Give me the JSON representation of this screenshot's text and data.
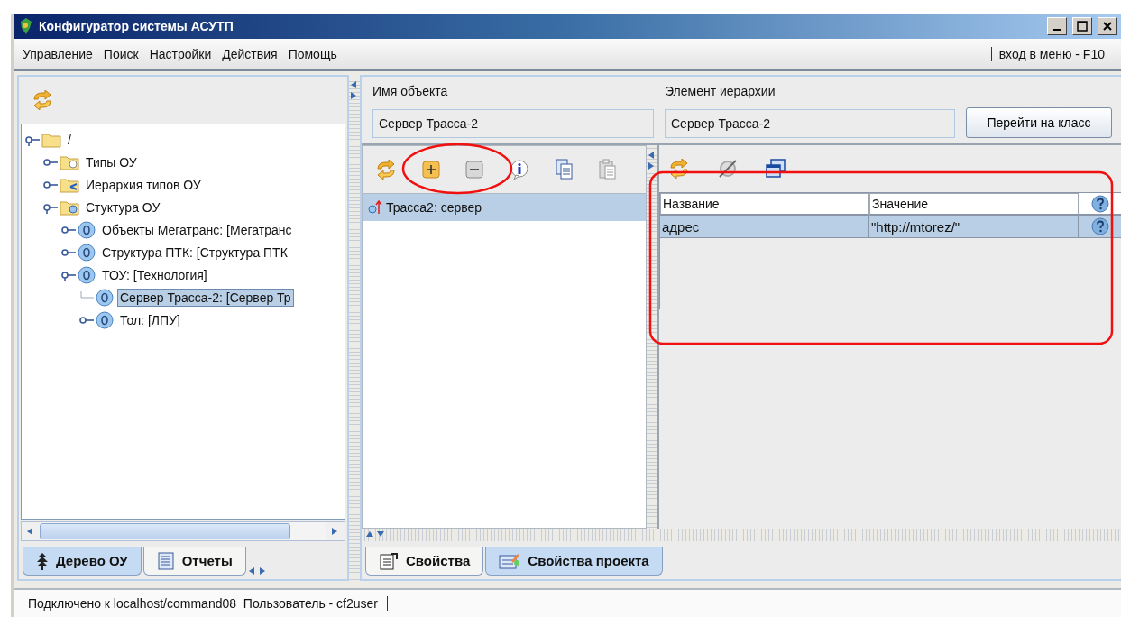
{
  "window": {
    "title": "Конфигуратор системы АСУТП"
  },
  "menu": {
    "items": [
      "Управление",
      "Поиск",
      "Настройки",
      "Действия",
      "Помощь"
    ],
    "hint": "вход в меню - F10"
  },
  "tree": {
    "items": [
      {
        "label": "/",
        "kind": "folder",
        "expanded": true,
        "selected": false,
        "children": [
          {
            "label": "Типы ОУ",
            "kind": "types",
            "expanded": false,
            "selected": false
          },
          {
            "label": "Иерархия типов ОУ",
            "kind": "hierarchy",
            "expanded": false,
            "selected": false
          },
          {
            "label": "Стуктура ОУ",
            "kind": "structure",
            "expanded": true,
            "selected": false,
            "children": [
              {
                "label": "Объекты Мегатранс: [Мегатранс",
                "kind": "object",
                "expanded": false,
                "selected": false
              },
              {
                "label": "Структура ПТК: [Структура ПТК",
                "kind": "object",
                "expanded": false,
                "selected": false
              },
              {
                "label": "ТОУ: [Технология]",
                "kind": "object",
                "expanded": true,
                "selected": false,
                "children": [
                  {
                    "label": "Сервер Трасса-2: [Сервер Тр",
                    "kind": "object",
                    "selected": true
                  },
                  {
                    "label": "Тол: [ЛПУ]",
                    "kind": "object",
                    "expanded": false,
                    "selected": false
                  }
                ]
              }
            ]
          }
        ]
      }
    ]
  },
  "left_tabs": [
    {
      "label": "Дерево ОУ",
      "selected": true
    },
    {
      "label": "Отчеты",
      "selected": false
    }
  ],
  "object_name": {
    "label": "Имя объекта",
    "value": "Сервер Трасса-2"
  },
  "hierarchy_element": {
    "label": "Элемент иерархии",
    "value": "Сервер Трасса-2"
  },
  "goto_class_button": "Перейти на класс",
  "object_list": {
    "items": [
      {
        "label": "Трасса2: сервер",
        "selected": true
      }
    ]
  },
  "properties": {
    "columns": [
      "Название",
      "Значение"
    ],
    "rows": [
      {
        "cells": [
          "адрес",
          "\"http://mtorez/\""
        ],
        "selected": true
      }
    ]
  },
  "right_tabs": [
    {
      "label": "Свойства",
      "selected": false
    },
    {
      "label": "Свойства проекта",
      "selected": true
    }
  ],
  "status_bar": {
    "text": "Подключено к localhost/command08  Пользователь - cf2user"
  }
}
